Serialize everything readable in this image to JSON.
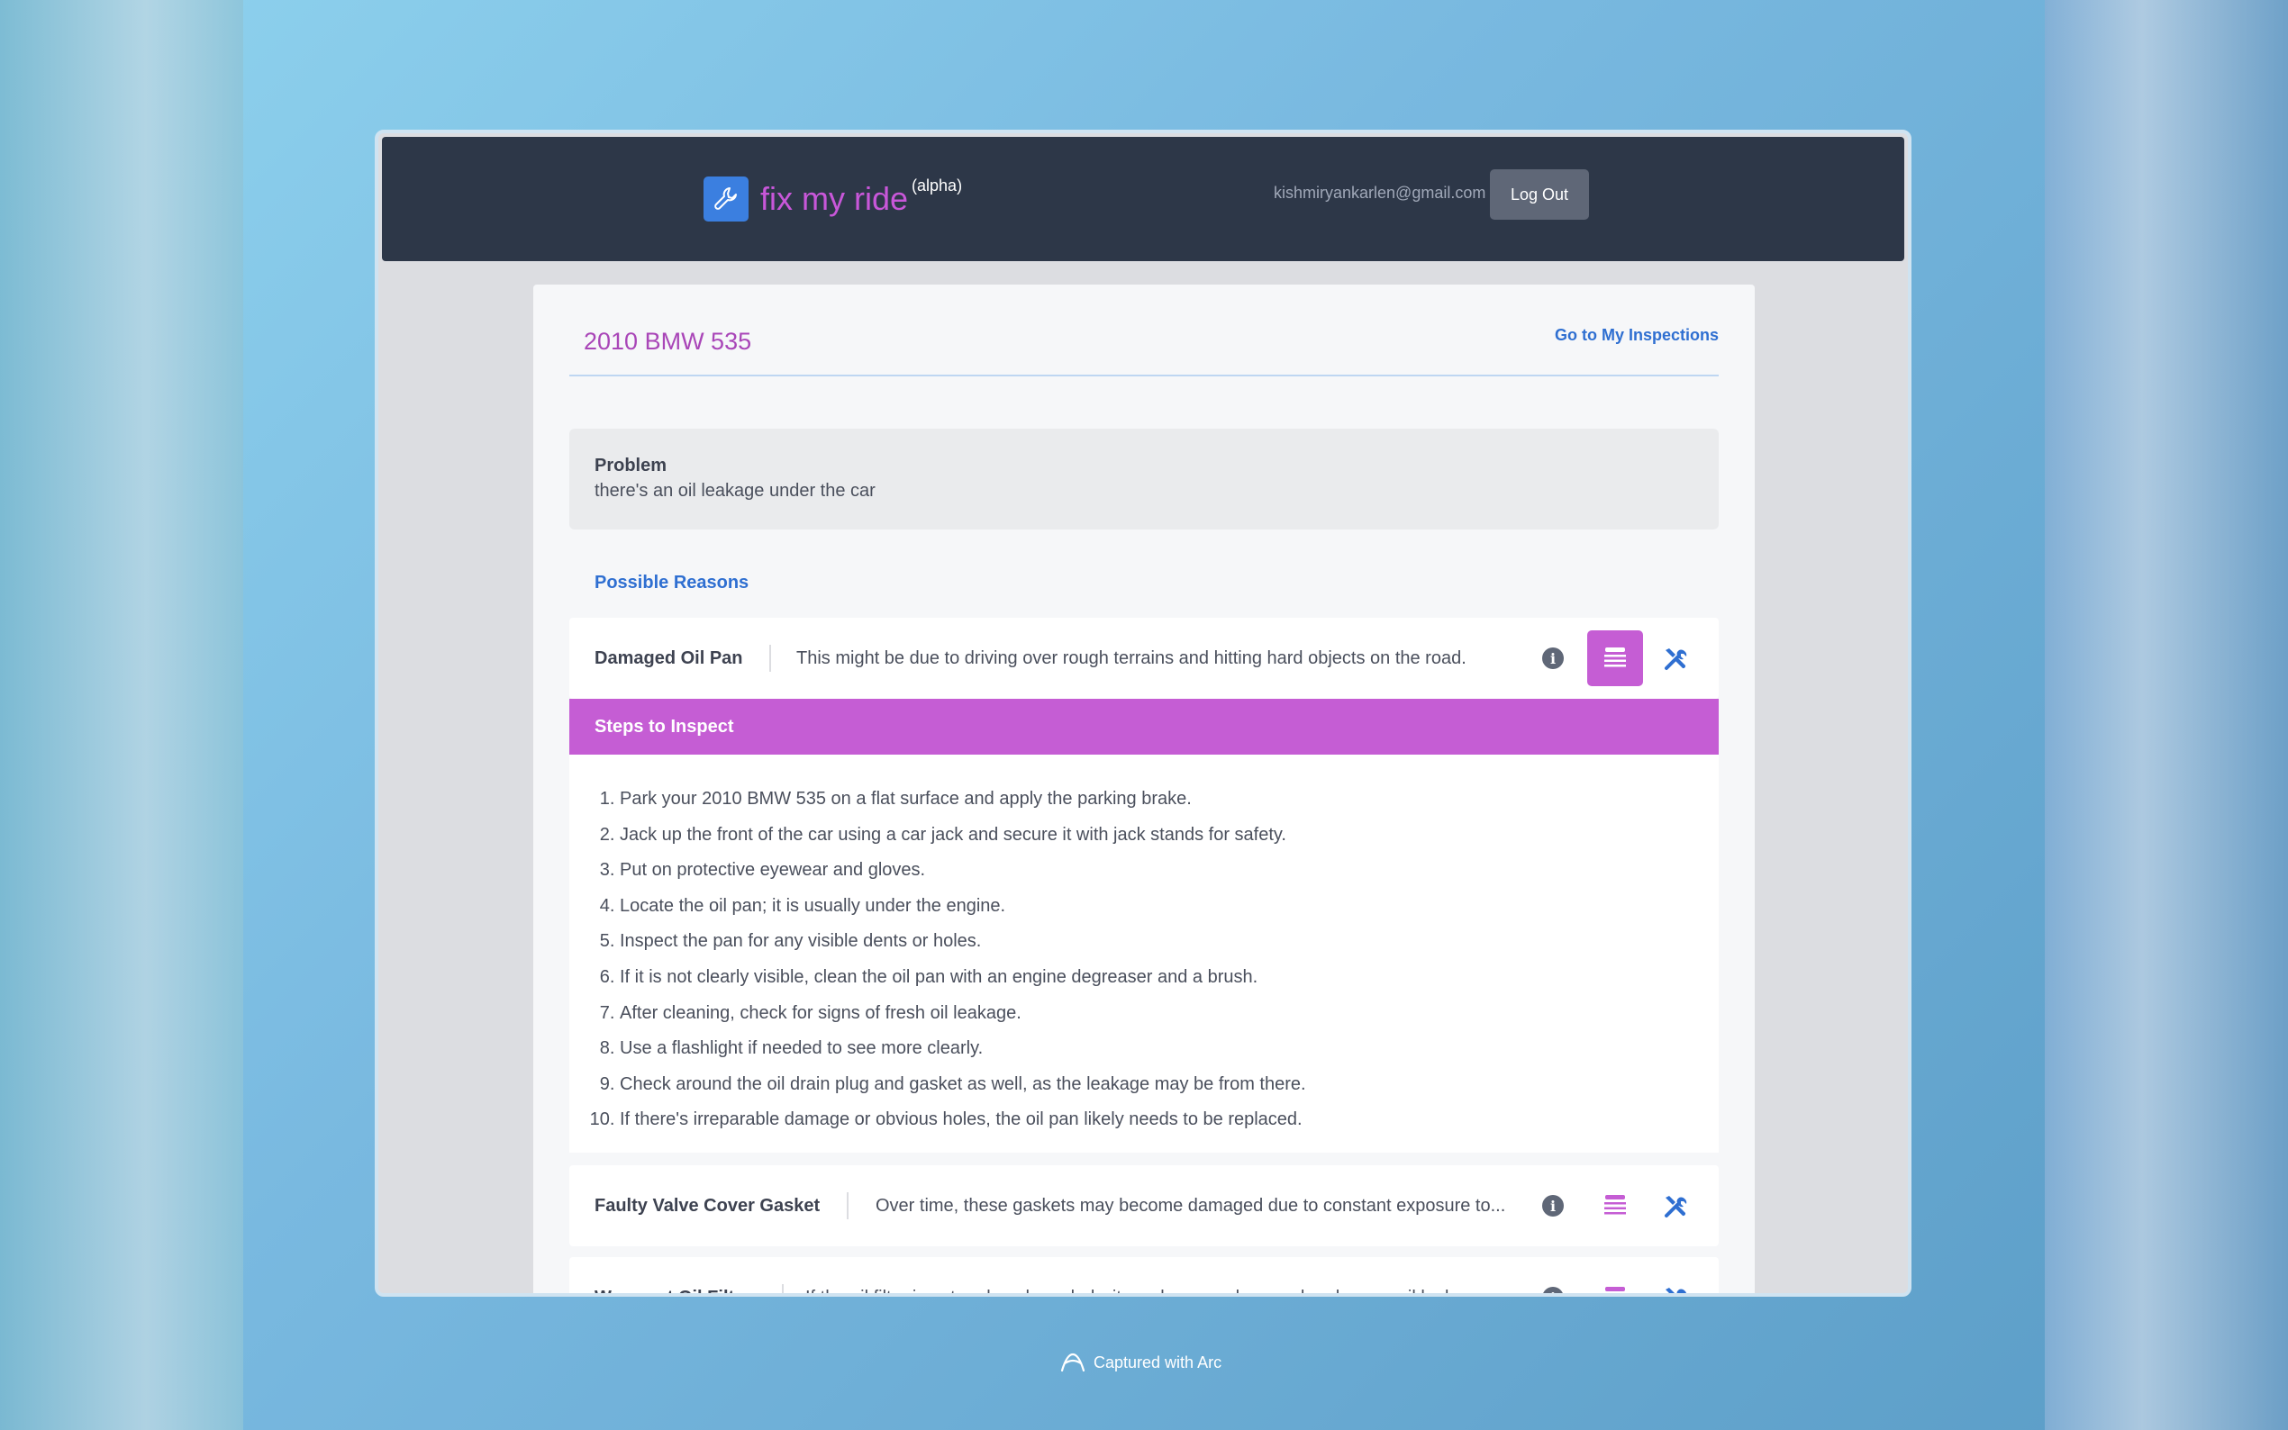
{
  "navbar": {
    "brand": "fix my ride",
    "brand_tag": "(alpha)",
    "email": "kishmiryankarlen@gmail.com",
    "logout_label": "Log Out"
  },
  "page": {
    "car_title": "2010 BMW 535",
    "go_link": "Go to My Inspections"
  },
  "problem": {
    "label": "Problem",
    "text": "there's an oil leakage under the car"
  },
  "reasons_heading": "Possible Reasons",
  "reasons": [
    {
      "name": "Damaged Oil Pan",
      "description": "This might be due to driving over rough terrains and hitting hard objects on the road."
    },
    {
      "name": "Faulty Valve Cover Gasket",
      "description": "Over time, these gaskets may become damaged due to constant exposure to..."
    },
    {
      "name": "Worn out Oil Filter",
      "description": "If the oil filter is not replaced regularly, it can become damaged and cause oil leaks"
    }
  ],
  "steps_heading": "Steps to Inspect",
  "steps": [
    "Park your 2010 BMW 535 on a flat surface and apply the parking brake.",
    "Jack up the front of the car using a car jack and secure it with jack stands for safety.",
    "Put on protective eyewear and gloves.",
    "Locate the oil pan; it is usually under the engine.",
    "Inspect the pan for any visible dents or holes.",
    "If it is not clearly visible, clean the oil pan with an engine degreaser and a brush.",
    "After cleaning, check for signs of fresh oil leakage.",
    "Use a flashlight if needed to see more clearly.",
    "Check around the oil drain plug and gasket as well, as the leakage may be from there.",
    "If there's irreparable damage or obvious holes, the oil pan likely needs to be replaced."
  ],
  "footer": "Captured with Arc",
  "colors": {
    "brand_purple": "#c857d9",
    "accent_blue": "#2f6fd1",
    "navbar_bg": "#2d3748"
  }
}
